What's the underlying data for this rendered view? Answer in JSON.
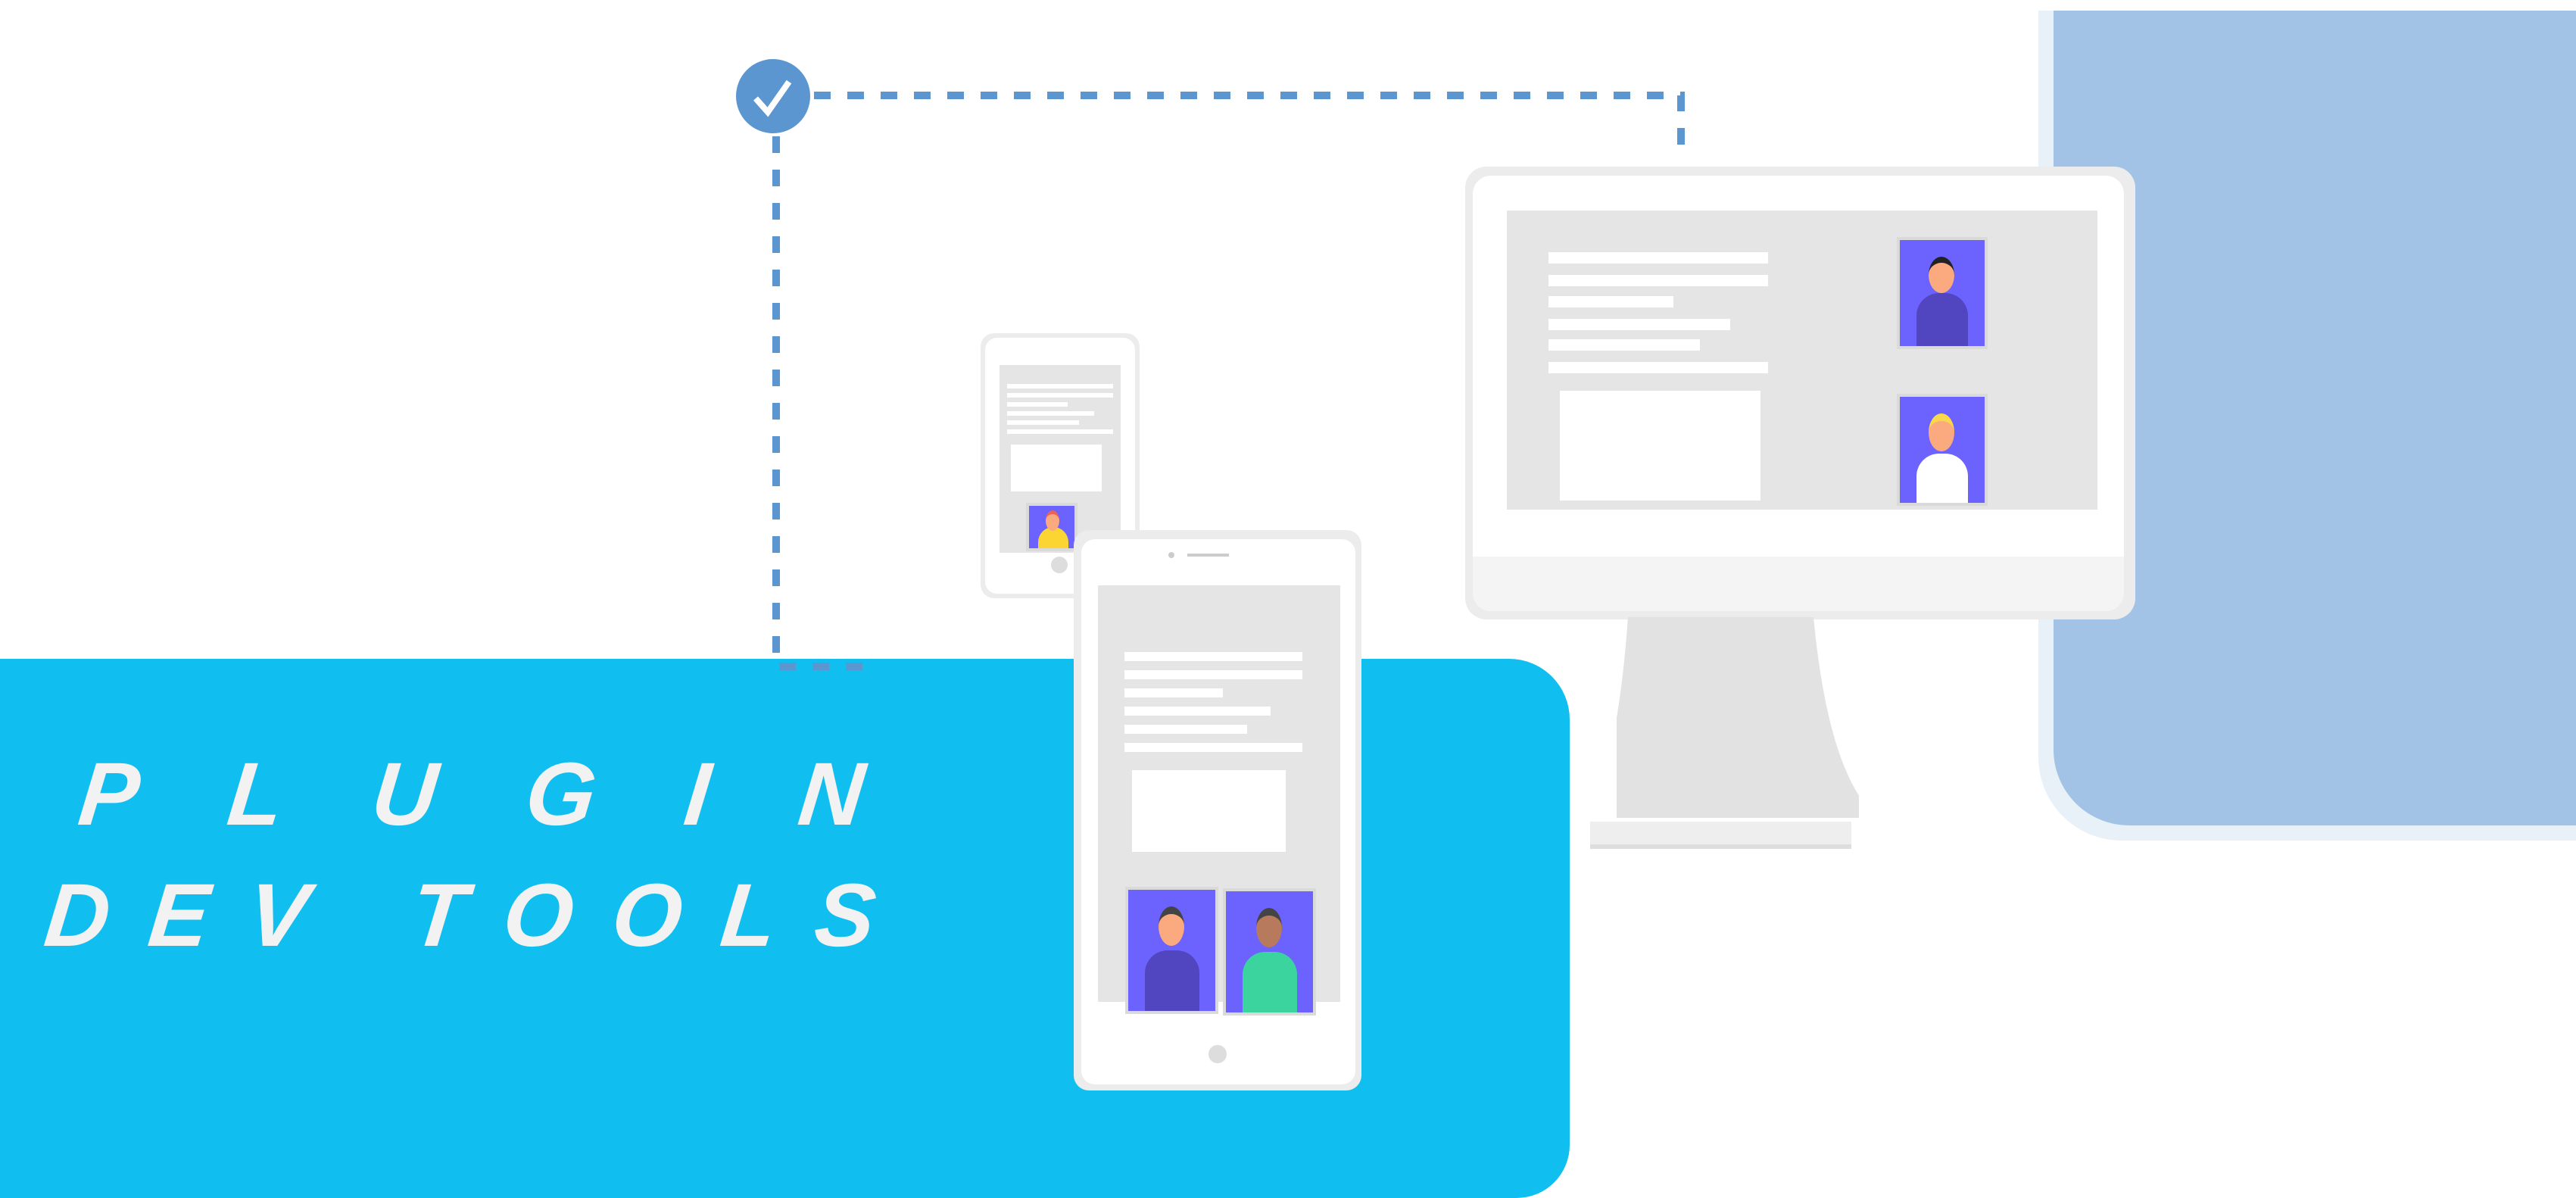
{
  "banner": {
    "line1": "PLUGIN",
    "line2": "DEV TOOLS"
  },
  "colors": {
    "banner": "#10bff0",
    "panel_outer": "#e8f0f8",
    "panel_inner": "#a3c3e6",
    "check": "#5b96d1",
    "avatar_bg": "#6c63ff"
  },
  "icons": [
    "check-circle-icon",
    "person-icon"
  ]
}
